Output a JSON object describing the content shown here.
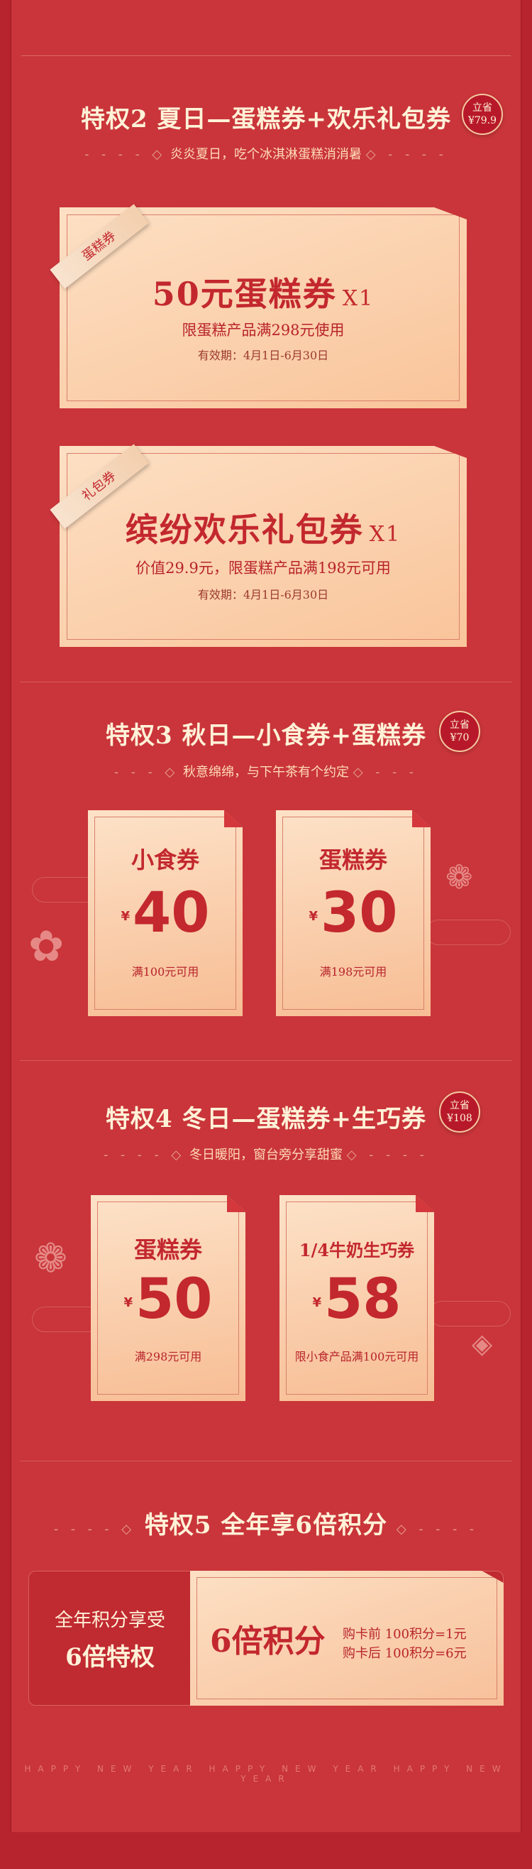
{
  "p2": {
    "title": "特权2  夏日—蛋糕券+欢乐礼包券",
    "badge_top": "立省",
    "badge_val": "¥79.9",
    "subtitle": "炎炎夏日，吃个冰淇淋蛋糕消消暑",
    "ticket1": {
      "ribbon": "蛋糕券",
      "name": "50元蛋糕券",
      "qty": "X1",
      "cond": "限蛋糕产品满298元使用",
      "valid": "有效期：4月1日-6月30日"
    },
    "ticket2": {
      "ribbon": "礼包券",
      "name": "缤纷欢乐礼包券",
      "qty": "X1",
      "cond": "价值29.9元，限蛋糕产品满198元可用",
      "valid": "有效期：4月1日-6月30日"
    }
  },
  "p3": {
    "title": "特权3  秋日—小食券+蛋糕券",
    "badge_top": "立省",
    "badge_val": "¥70",
    "subtitle": "秋意绵绵，与下午茶有个约定",
    "coupons": [
      {
        "name": "小食券",
        "yen": "¥",
        "amount": "40",
        "note": "满100元可用"
      },
      {
        "name": "蛋糕券",
        "yen": "¥",
        "amount": "30",
        "note": "满198元可用"
      }
    ]
  },
  "p4": {
    "title": "特权4  冬日—蛋糕券+生巧券",
    "badge_top": "立省",
    "badge_val": "¥108",
    "subtitle": "冬日暖阳，窗台旁分享甜蜜",
    "coupons": [
      {
        "name": "蛋糕券",
        "yen": "¥",
        "amount": "50",
        "note": "满298元可用"
      },
      {
        "name": "1/4牛奶生巧券",
        "yen": "¥",
        "amount": "58",
        "note": "限小食产品满100元可用"
      }
    ]
  },
  "p5": {
    "title": "特权5  全年享6倍积分",
    "left_line1": "全年积分享受",
    "left_line2": "6倍特权",
    "big": "6倍积分",
    "rule1": "购卡前 100积分=1元",
    "rule2": "购卡后 100积分=6元"
  },
  "footer": "HAPPY NEW YEAR HAPPY NEW YEAR HAPPY NEW YEAR",
  "colors": {
    "bg": "#c9353a",
    "accent": "#c3282e",
    "card": "#fbd3b0",
    "title": "#fff2d8"
  }
}
